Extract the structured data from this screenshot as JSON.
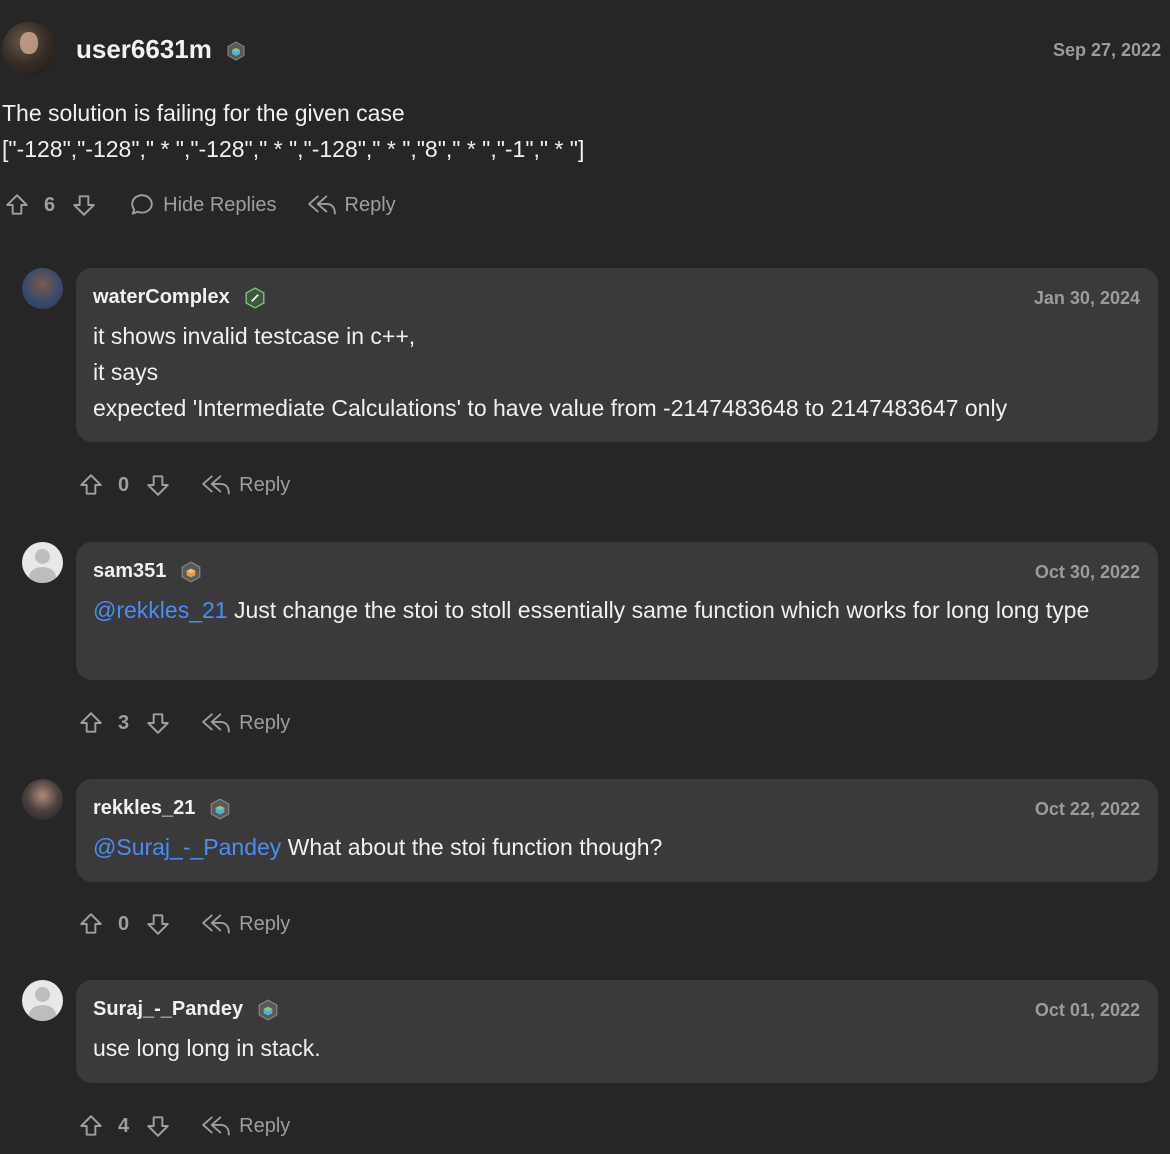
{
  "top": {
    "user": "user6631m",
    "date": "Sep 27, 2022",
    "text_line1": "The solution is failing for the given case",
    "text_line2": "[\"-128\",\"-128\",\" * \",\"-128\",\" * \",\"-128\",\" * \",\"8\",\" * \",\"-1\",\" * \"]",
    "votes": "6",
    "hide_replies": "Hide Replies",
    "reply": "Reply"
  },
  "replies": [
    {
      "user": "waterComplex",
      "date": "Jan 30, 2024",
      "lines": [
        "it shows invalid testcase in c++,",
        "it says",
        "expected 'Intermediate Calculations' to have value from -2147483648 to 2147483647 only"
      ],
      "votes": "0",
      "reply": "Reply"
    },
    {
      "user": "sam351",
      "date": "Oct 30, 2022",
      "mention": "@rekkles_21",
      "text": " Just change the stoi to stoll essentially same function which works for long long type",
      "votes": "3",
      "reply": "Reply"
    },
    {
      "user": "rekkles_21",
      "date": "Oct 22, 2022",
      "mention": "@Suraj_-_Pandey",
      "text": " What about the stoi function though?",
      "votes": "0",
      "reply": "Reply"
    },
    {
      "user": "Suraj_-_Pandey",
      "date": "Oct 01, 2022",
      "text": "use long long in stack.",
      "votes": "4",
      "reply": "Reply"
    }
  ],
  "icons": {
    "upvote": "arrow-up-outline-icon",
    "downvote": "arrow-down-outline-icon",
    "comment": "speech-bubble-icon",
    "reply": "reply-arrow-icon",
    "badge": "cube-badge-icon"
  },
  "colors": {
    "background": "#262626",
    "card": "#3a3a3a",
    "mention": "#4c8df5",
    "muted": "#9e9e9e"
  }
}
